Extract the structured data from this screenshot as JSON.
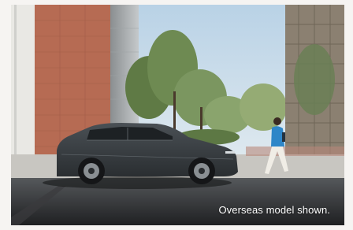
{
  "hero": {
    "caption": "Overseas model shown."
  },
  "colors": {
    "page_background": "#f6f4f2",
    "sky": "#b9d2e6",
    "brick": "#b66b53",
    "vehicle_body": "#3a3f43",
    "road": "#2f3032",
    "caption_text": "#ffffff"
  },
  "icons": {
    "vehicle": "suv-silhouette",
    "pedestrian": "walking-person"
  }
}
